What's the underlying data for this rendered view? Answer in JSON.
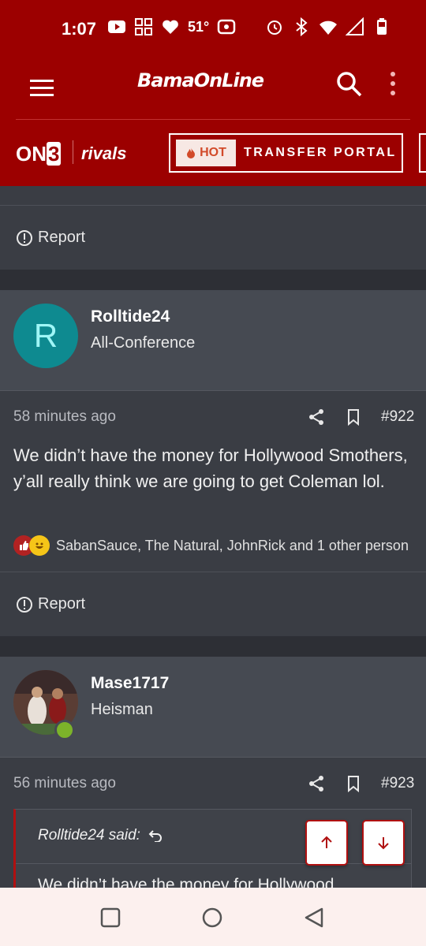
{
  "status_bar": {
    "time": "1:07",
    "temperature": "51°",
    "icons_left": [
      "youtube-icon",
      "grid-app-icon",
      "heart-icon"
    ],
    "icons_right": [
      "alarm-icon",
      "bluetooth-icon",
      "wifi-icon",
      "signal-icon",
      "battery-icon"
    ]
  },
  "header": {
    "logo": "BamaOnLine"
  },
  "brand_bar": {
    "on3_text": "ON",
    "on3_num": "3",
    "rivals": "rivals",
    "hot_badge": "HOT",
    "transfer_portal": "TRANSFER PORTAL"
  },
  "posts": [
    {
      "report_label": "Report"
    },
    {
      "avatar_letter": "R",
      "username": "Rolltide24",
      "user_title": "All-Conference",
      "time": "58 minutes ago",
      "post_number": "#922",
      "body": "We didn’t have the money for Hollywood Smothers, y’all really think we are going to get Coleman lol.",
      "reaction_names": "SabanSauce, The Natural, JohnRick and 1 other person",
      "report_label": "Report"
    },
    {
      "username": "Mase1717",
      "user_title": "Heisman",
      "time": "56 minutes ago",
      "post_number": "#923",
      "quote_author": "Rolltide24 said:",
      "quote_text": "We didn’t have the money for Hollywood"
    }
  ],
  "colors": {
    "brand_red": "#9c0000",
    "background": "#3a3d44",
    "user_block": "#464a52",
    "avatar_teal": "#0e8a90",
    "online_green": "#7cb32a"
  }
}
